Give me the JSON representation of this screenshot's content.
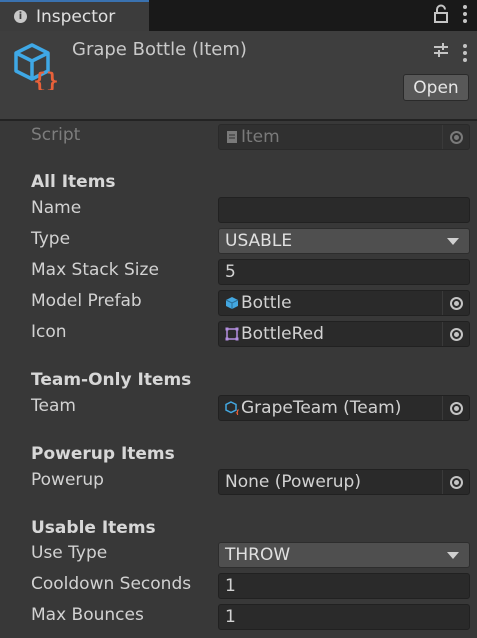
{
  "tab": {
    "label": "Inspector"
  },
  "header": {
    "title": "Grape Bottle (Item)",
    "open_label": "Open"
  },
  "script": {
    "label": "Script",
    "value": "Item"
  },
  "sections": {
    "all_items": "All Items",
    "team_only": "Team-Only Items",
    "powerup": "Powerup Items",
    "usable": "Usable Items"
  },
  "fields": {
    "name": {
      "label": "Name",
      "value": ""
    },
    "type": {
      "label": "Type",
      "value": "USABLE"
    },
    "max_stack": {
      "label": "Max Stack Size",
      "value": "5"
    },
    "model_prefab": {
      "label": "Model Prefab",
      "value": "Bottle"
    },
    "icon": {
      "label": "Icon",
      "value": "BottleRed"
    },
    "team": {
      "label": "Team",
      "value": "GrapeTeam (Team)"
    },
    "powerup": {
      "label": "Powerup",
      "value": "None (Powerup)"
    },
    "use_type": {
      "label": "Use Type",
      "value": "THROW"
    },
    "cooldown": {
      "label": "Cooldown Seconds",
      "value": "1"
    },
    "max_bounces": {
      "label": "Max Bounces",
      "value": "1"
    }
  },
  "colors": {
    "accent": "#3a72b0",
    "background": "#383838",
    "field": "#2a2a2a"
  }
}
